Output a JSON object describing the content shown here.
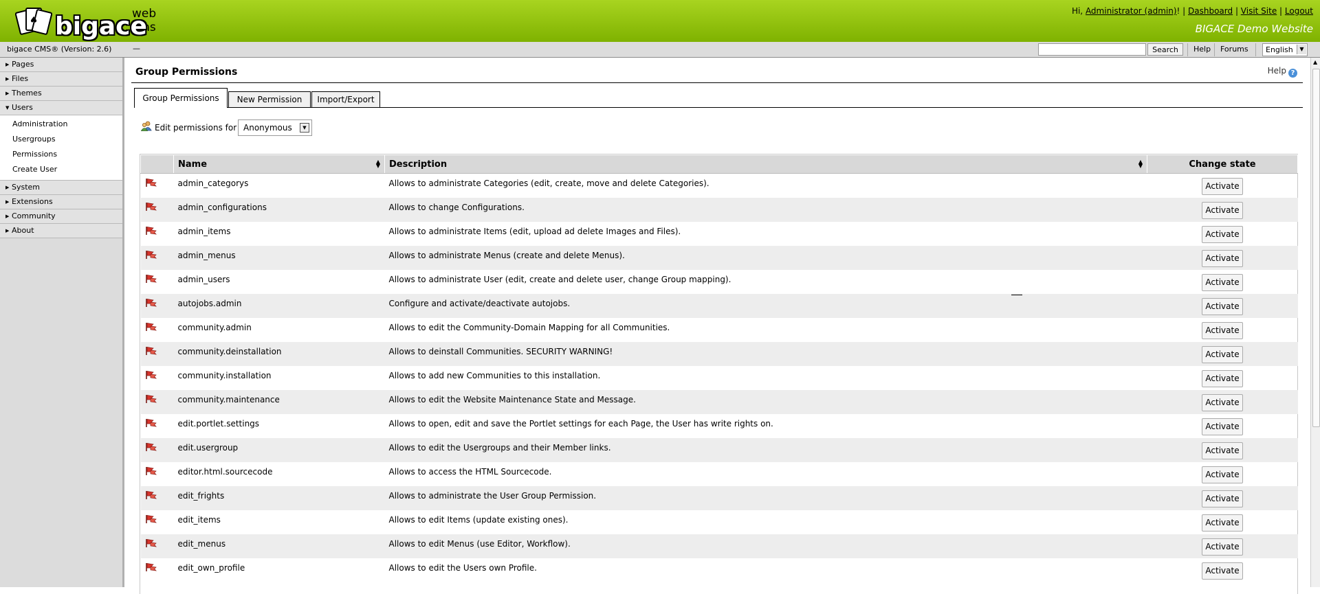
{
  "header": {
    "logo_tag": "web cms",
    "logo_word": "bigace",
    "greeting_prefix": "Hi, ",
    "user_link": "Administrator (admin)",
    "greeting_suffix": "! | ",
    "dashboard": "Dashboard",
    "sep1": " | ",
    "visit_site": "Visit Site",
    "sep2": " | ",
    "logout": "Logout",
    "site_name": "BIGACE Demo Website"
  },
  "subbar": {
    "version": "bigace CMS® (Version: 2.6)",
    "dash": "—",
    "search_value": "",
    "search_button": "Search",
    "help": "Help",
    "forums": "Forums",
    "language": "English"
  },
  "sidebar": {
    "items": [
      {
        "label": "Pages",
        "expanded": false
      },
      {
        "label": "Files",
        "expanded": false
      },
      {
        "label": "Themes",
        "expanded": false
      },
      {
        "label": "Users",
        "expanded": true
      },
      {
        "label": "System",
        "expanded": false
      },
      {
        "label": "Extensions",
        "expanded": false
      },
      {
        "label": "Community",
        "expanded": false
      },
      {
        "label": "About",
        "expanded": false
      }
    ],
    "users_sub": [
      "Administration",
      "Usergroups",
      "Permissions",
      "Create User"
    ]
  },
  "main": {
    "title": "Group Permissions",
    "help": "Help",
    "tabs": [
      "Group Permissions",
      "New Permission",
      "Import/Export"
    ],
    "edit_label": "Edit permissions for",
    "group_selected": "Anonymous",
    "columns": [
      "Name",
      "Description",
      "Change state"
    ],
    "action_label": "Activate",
    "rows": [
      {
        "name": "admin_categorys",
        "desc": "Allows to administrate Categories (edit, create, move and delete Categories)."
      },
      {
        "name": "admin_configurations",
        "desc": "Allows to change Configurations."
      },
      {
        "name": "admin_items",
        "desc": "Allows to administrate Items (edit, upload ad delete Images and Files)."
      },
      {
        "name": "admin_menus",
        "desc": "Allows to administrate Menus (create and delete Menus)."
      },
      {
        "name": "admin_users",
        "desc": "Allows to administrate User (edit, create and delete user, change Group mapping)."
      },
      {
        "name": "autojobs.admin",
        "desc": "Configure and activate/deactivate autojobs."
      },
      {
        "name": "community.admin",
        "desc": "Allows to edit the Community-Domain Mapping for all Communities."
      },
      {
        "name": "community.deinstallation",
        "desc": "Allows to deinstall Communities. SECURITY WARNING!"
      },
      {
        "name": "community.installation",
        "desc": "Allows to add new Communities to this installation."
      },
      {
        "name": "community.maintenance",
        "desc": "Allows to edit the Website Maintenance State and Message."
      },
      {
        "name": "edit.portlet.settings",
        "desc": "Allows to open, edit and save the Portlet settings for each Page, the User has write rights on."
      },
      {
        "name": "edit.usergroup",
        "desc": "Allows to edit the Usergroups and their Member links."
      },
      {
        "name": "editor.html.sourcecode",
        "desc": "Allows to access the HTML Sourcecode."
      },
      {
        "name": "edit_frights",
        "desc": "Allows to administrate the User Group Permission."
      },
      {
        "name": "edit_items",
        "desc": "Allows to edit Items (update existing ones)."
      },
      {
        "name": "edit_menus",
        "desc": "Allows to edit Menus (use Editor, Workflow)."
      },
      {
        "name": "edit_own_profile",
        "desc": "Allows to edit the Users own Profile."
      }
    ]
  },
  "colors": {
    "header_green": "#8cc30a",
    "flag_red": "#d8342c"
  }
}
